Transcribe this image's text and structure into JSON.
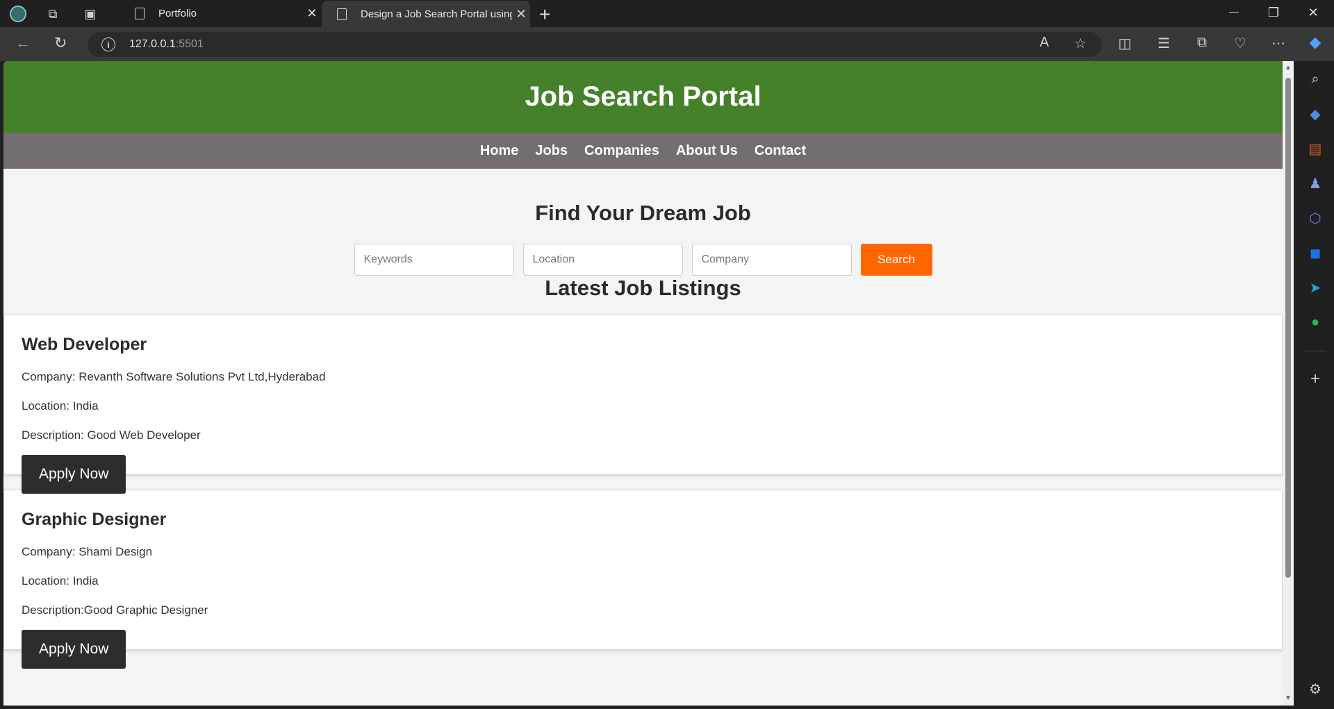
{
  "browser": {
    "tabs": [
      {
        "title": "Portfolio",
        "active": false
      },
      {
        "title": "Design a Job Search Portal using",
        "active": true
      }
    ],
    "url": {
      "host": "127.0.0.1",
      "port": ":5501"
    },
    "new_tab_glyph": "+",
    "close_glyph": "✕",
    "window_controls": {
      "minimize": "—",
      "restore": "❐",
      "close": "✕"
    }
  },
  "site": {
    "title": "Job Search Portal",
    "nav": [
      "Home",
      "Jobs",
      "Companies",
      "About Us",
      "Contact"
    ],
    "search": {
      "heading": "Find Your Dream Job",
      "keywords_placeholder": "Keywords",
      "location_placeholder": "Location",
      "company_placeholder": "Company",
      "button_label": "Search"
    },
    "listings_heading": "Latest Job Listings",
    "jobs": [
      {
        "title": "Web Developer",
        "company": "Company: Revanth Software Solutions Pvt Ltd,Hyderabad",
        "location": "Location: India",
        "description": "Description: Good Web Developer",
        "apply_label": "Apply Now"
      },
      {
        "title": "Graphic Designer",
        "company": "Company: Shami Design",
        "location": "Location: India",
        "description": "Description:Good Graphic Designer",
        "apply_label": "Apply Now"
      }
    ]
  },
  "colors": {
    "header_green": "#45812b",
    "nav_gray": "#746e6e",
    "search_orange": "#ff6600",
    "apply_dark": "#2d2d2d"
  }
}
